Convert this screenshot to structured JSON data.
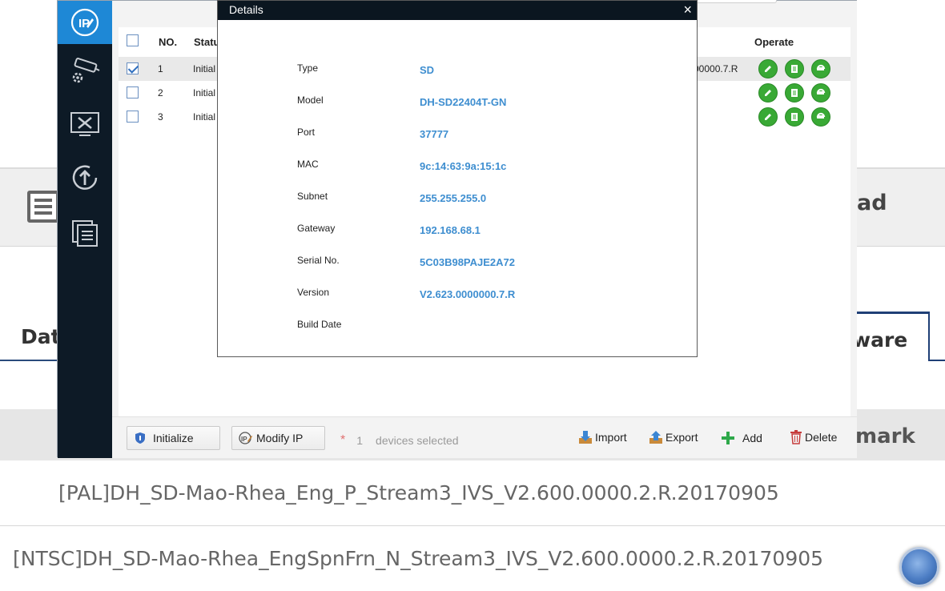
{
  "background": {
    "band_right_text": "ad",
    "tab_left_label": "Dat",
    "tab_right_label": "ware",
    "remark_header": "mark",
    "rows": [
      "[PAL]DH_SD-Mao-Rhea_Eng_P_Stream3_IVS_V2.600.0000.2.R.20170905",
      "[NTSC]DH_SD-Mao-Rhea_EngSpnFrn_N_Stream3_IVS_V2.600.0000.2.R.20170905"
    ]
  },
  "sidebar": {
    "logo_text": "IP",
    "items": [
      {
        "icon": "ip-logo-icon",
        "active": true
      },
      {
        "icon": "camera-settings-icon",
        "active": false
      },
      {
        "icon": "tools-monitor-icon",
        "active": false
      },
      {
        "icon": "upgrade-icon",
        "active": false
      },
      {
        "icon": "document-list-icon",
        "active": false
      }
    ]
  },
  "table": {
    "headers": {
      "no": "NO.",
      "status": "Statu",
      "operate": "Operate"
    },
    "rows": [
      {
        "no": "1",
        "status": "Initial",
        "version_fragment": "00000.7.R",
        "checked": true
      },
      {
        "no": "2",
        "status": "Initial",
        "version_fragment": "",
        "checked": false
      },
      {
        "no": "3",
        "status": "Initial",
        "version_fragment": "",
        "checked": false
      }
    ],
    "operate_icons": [
      "edit-icon",
      "details-icon",
      "web-icon"
    ]
  },
  "bottombar": {
    "initialize_label": "Initialize",
    "modify_ip_label": "Modify IP",
    "star": "*",
    "selected_count": "1",
    "selected_text": "devices selected",
    "import_label": "Import",
    "export_label": "Export",
    "add_label": "Add",
    "delete_label": "Delete"
  },
  "dialog": {
    "title": "Details",
    "close_glyph": "×",
    "fields": [
      {
        "label": "Type",
        "value": "SD"
      },
      {
        "label": "Model",
        "value": "DH-SD22404T-GN"
      },
      {
        "label": "Port",
        "value": "37777"
      },
      {
        "label": "MAC",
        "value": "9c:14:63:9a:15:1c"
      },
      {
        "label": "Subnet",
        "value": "255.255.255.0"
      },
      {
        "label": "Gateway",
        "value": "192.168.68.1"
      },
      {
        "label": "Serial No.",
        "value": "5C03B98PAJE2A72"
      },
      {
        "label": "Version",
        "value": "V2.623.0000000.7.R"
      },
      {
        "label": "Build Date",
        "value": ""
      }
    ]
  },
  "colors": {
    "accent": "#1e88d6",
    "sidebar": "#0d1a26",
    "value_text": "#3e8ed0",
    "operate_green": "#39a935"
  }
}
